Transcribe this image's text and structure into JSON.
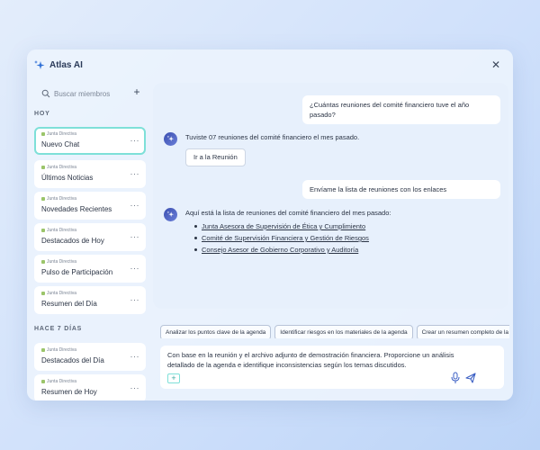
{
  "app": {
    "title": "Atlas AI"
  },
  "sidebar": {
    "search_placeholder": "Buscar miembros",
    "sections": [
      {
        "label": "HOY"
      },
      {
        "label": "HACE 7 DÍAS"
      }
    ],
    "items": [
      {
        "tag": "Junta Directiva",
        "title": "Nuevo Chat"
      },
      {
        "tag": "Junta Directiva",
        "title": "Últimos Noticias"
      },
      {
        "tag": "Junta Directiva",
        "title": "Novedades Recientes"
      },
      {
        "tag": "Junta Directiva",
        "title": "Destacados de Hoy"
      },
      {
        "tag": "Junta Directiva",
        "title": "Pulso de Participación"
      },
      {
        "tag": "Junta Directiva",
        "title": "Resumen del Día"
      },
      {
        "tag": "Junta Directiva",
        "title": "Destacados del Día"
      },
      {
        "tag": "Junta Directiva",
        "title": "Resumen de Hoy"
      }
    ]
  },
  "chat": {
    "user_message_1": "¿Cuántas reuniones del comité financiero tuve el año pasado?",
    "bot_message_1": "Tuviste 07 reuniones del comité financiero el mes pasado.",
    "bot_button_1": "Ir a la Reunión",
    "user_message_2": "Envíame la lista de reuniones con los enlaces",
    "bot_message_2": "Aquí está la lista de reuniones del comité financiero del mes pasado:",
    "links": [
      "Junta Asesora de Supervisión de Ética y Cumplimiento",
      "Comité de Supervisión Financiera y Gestión de Riesgos",
      "Consejo Asesor de Gobierno Corporativo y Auditoría"
    ]
  },
  "suggestions": [
    "Analizar los puntos clave de la agenda",
    "Identificar riesgos en los materiales de la agenda",
    "Crear un resumen completo de la reunión"
  ],
  "composer": {
    "text": "Con base en la reunión y el archivo adjunto de demostración financiera. Proporcione un análisis detallado de la agenda e identifique inconsistencias según los temas discutidos."
  },
  "colors": {
    "accent": "#7ee0d8",
    "bot_avatar": "#3b4fb0",
    "tag_dot": "#9bc56a"
  }
}
